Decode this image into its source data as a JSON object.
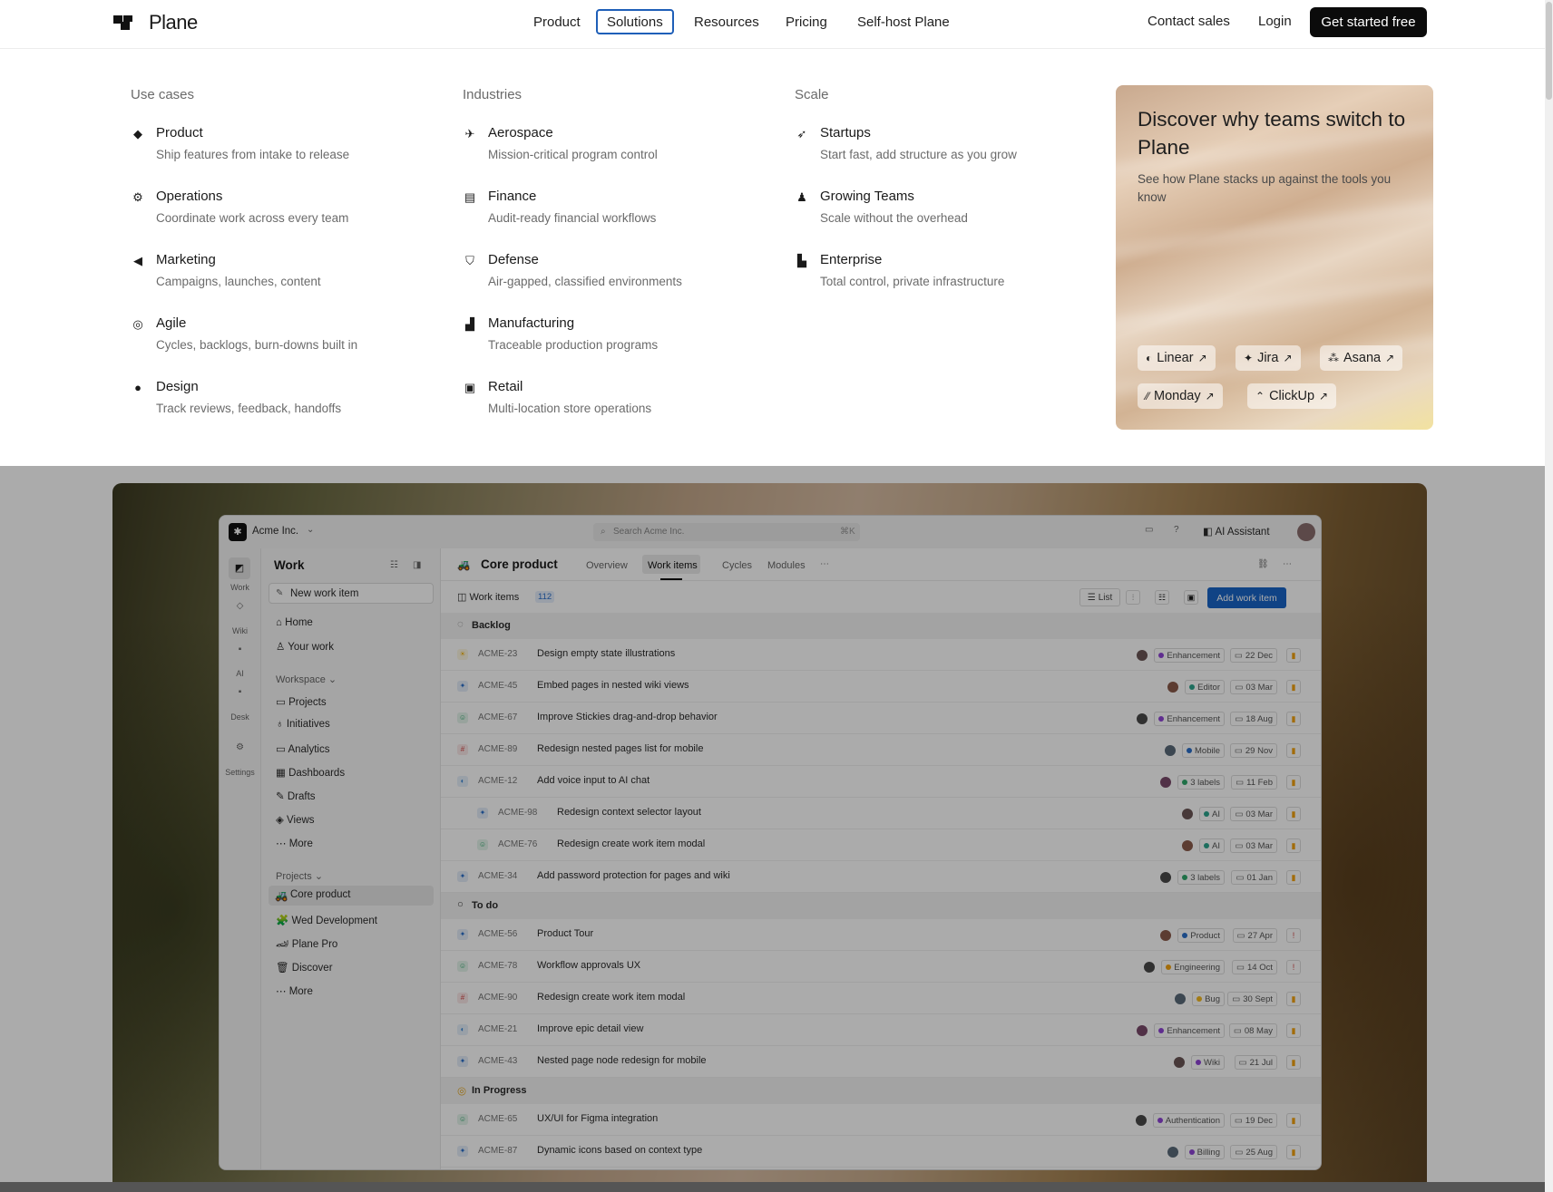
{
  "header": {
    "logo_text": "Plane",
    "nav": [
      {
        "label": "Product"
      },
      {
        "label": "Solutions"
      },
      {
        "label": "Resources"
      },
      {
        "label": "Pricing"
      },
      {
        "label": "Self-host Plane"
      }
    ],
    "contact_sales": "Contact sales",
    "login": "Login",
    "cta": "Get started free"
  },
  "menu": {
    "use_cases": {
      "title": "Use cases",
      "items": [
        {
          "icon": "cube-icon",
          "title": "Product",
          "desc": "Ship features from intake to release"
        },
        {
          "icon": "gear-icon",
          "title": "Operations",
          "desc": "Coordinate work across every team"
        },
        {
          "icon": "megaphone-icon",
          "title": "Marketing",
          "desc": "Campaigns, launches, content"
        },
        {
          "icon": "target-icon",
          "title": "Agile",
          "desc": "Cycles, backlogs, burn-downs built in"
        },
        {
          "icon": "palette-icon",
          "title": "Design",
          "desc": "Track reviews, feedback, handoffs"
        }
      ]
    },
    "industries": {
      "title": "Industries",
      "items": [
        {
          "icon": "plane-icon",
          "title": "Aerospace",
          "desc": "Mission-critical program control"
        },
        {
          "icon": "database-icon",
          "title": "Finance",
          "desc": "Audit-ready financial workflows"
        },
        {
          "icon": "shield-icon",
          "title": "Defense",
          "desc": "Air-gapped, classified environments"
        },
        {
          "icon": "factory-icon",
          "title": "Manufacturing",
          "desc": "Traceable production programs"
        },
        {
          "icon": "store-icon",
          "title": "Retail",
          "desc": "Multi-location store operations"
        }
      ]
    },
    "scale": {
      "title": "Scale",
      "items": [
        {
          "icon": "rocket-icon",
          "title": "Startups",
          "desc": "Start fast, add structure as you grow"
        },
        {
          "icon": "users-icon",
          "title": "Growing Teams",
          "desc": "Scale without the overhead"
        },
        {
          "icon": "building-icon",
          "title": "Enterprise",
          "desc": "Total control, private infrastructure"
        }
      ]
    },
    "promo": {
      "title": "Discover why teams switch to Plane",
      "desc": "See how Plane stacks up against the tools you know",
      "chips": [
        "Linear",
        "Jira",
        "Asana",
        "Monday",
        "ClickUp"
      ]
    }
  },
  "app": {
    "workspace": "Acme Inc.",
    "search_placeholder": "Search Acme Inc.",
    "search_shortcut": "⌘K",
    "ai_assistant": "AI Assistant",
    "rail": [
      "Work",
      "Wiki",
      "AI",
      "Desk",
      "Settings"
    ],
    "sidebar": {
      "title": "Work",
      "new_item": "New work item",
      "top": [
        "Home",
        "Your work"
      ],
      "workspace_label": "Workspace",
      "workspace_items": [
        "Projects",
        "Initiatives",
        "Analytics",
        "Dashboards",
        "Drafts",
        "Views",
        "More"
      ],
      "projects_label": "Projects",
      "projects": [
        "Core product",
        "Wed Development",
        "Plane Pro",
        "Discover",
        "More"
      ]
    },
    "main": {
      "project": "Core product",
      "tabs": [
        "Overview",
        "Work items",
        "Cycles",
        "Modules"
      ],
      "work_items_label": "Work items",
      "work_items_count": "112",
      "list_btn": "List",
      "add_btn": "Add work item",
      "groups": [
        {
          "name": "Backlog",
          "rows": [
            {
              "id": "ACME-23",
              "title": "Design empty state illustrations",
              "label": "Enhancement",
              "date": "22 Dec"
            },
            {
              "id": "ACME-45",
              "title": "Embed pages in nested wiki views",
              "label": "Editor",
              "date": "03 Mar"
            },
            {
              "id": "ACME-67",
              "title": "Improve Stickies drag-and-drop behavior",
              "label": "Enhancement",
              "date": "18 Aug"
            },
            {
              "id": "ACME-89",
              "title": "Redesign nested pages list for mobile",
              "label": "Mobile",
              "date": "29 Nov"
            },
            {
              "id": "ACME-12",
              "title": "Add voice input to AI chat",
              "label": "3 labels",
              "date": "11 Feb"
            },
            {
              "id": "ACME-98",
              "title": "Redesign context selector layout",
              "label": "AI",
              "date": "03 Mar"
            },
            {
              "id": "ACME-76",
              "title": "Redesign create work item modal",
              "label": "AI",
              "date": "03 Mar"
            },
            {
              "id": "ACME-34",
              "title": "Add password protection for pages and wiki",
              "label": "3 labels",
              "date": "01 Jan"
            }
          ]
        },
        {
          "name": "To do",
          "rows": [
            {
              "id": "ACME-56",
              "title": "Product Tour",
              "label": "Product",
              "date": "27 Apr"
            },
            {
              "id": "ACME-78",
              "title": "Workflow approvals UX",
              "label": "Engineering",
              "date": "14 Oct"
            },
            {
              "id": "ACME-90",
              "title": "Redesign create work item modal",
              "label": "Bug",
              "date": "30 Sept"
            },
            {
              "id": "ACME-21",
              "title": "Improve epic detail view",
              "label": "Enhancement",
              "date": "08 May"
            },
            {
              "id": "ACME-43",
              "title": "Nested page node redesign for mobile",
              "label": "Wiki",
              "date": "21 Jul"
            }
          ]
        },
        {
          "name": "In Progress",
          "rows": [
            {
              "id": "ACME-65",
              "title": "UX/UI for Figma integration",
              "label": "Authentication",
              "date": "19 Dec"
            },
            {
              "id": "ACME-87",
              "title": "Dynamic icons based on context type",
              "label": "Billing",
              "date": "25 Aug"
            }
          ]
        }
      ]
    }
  }
}
